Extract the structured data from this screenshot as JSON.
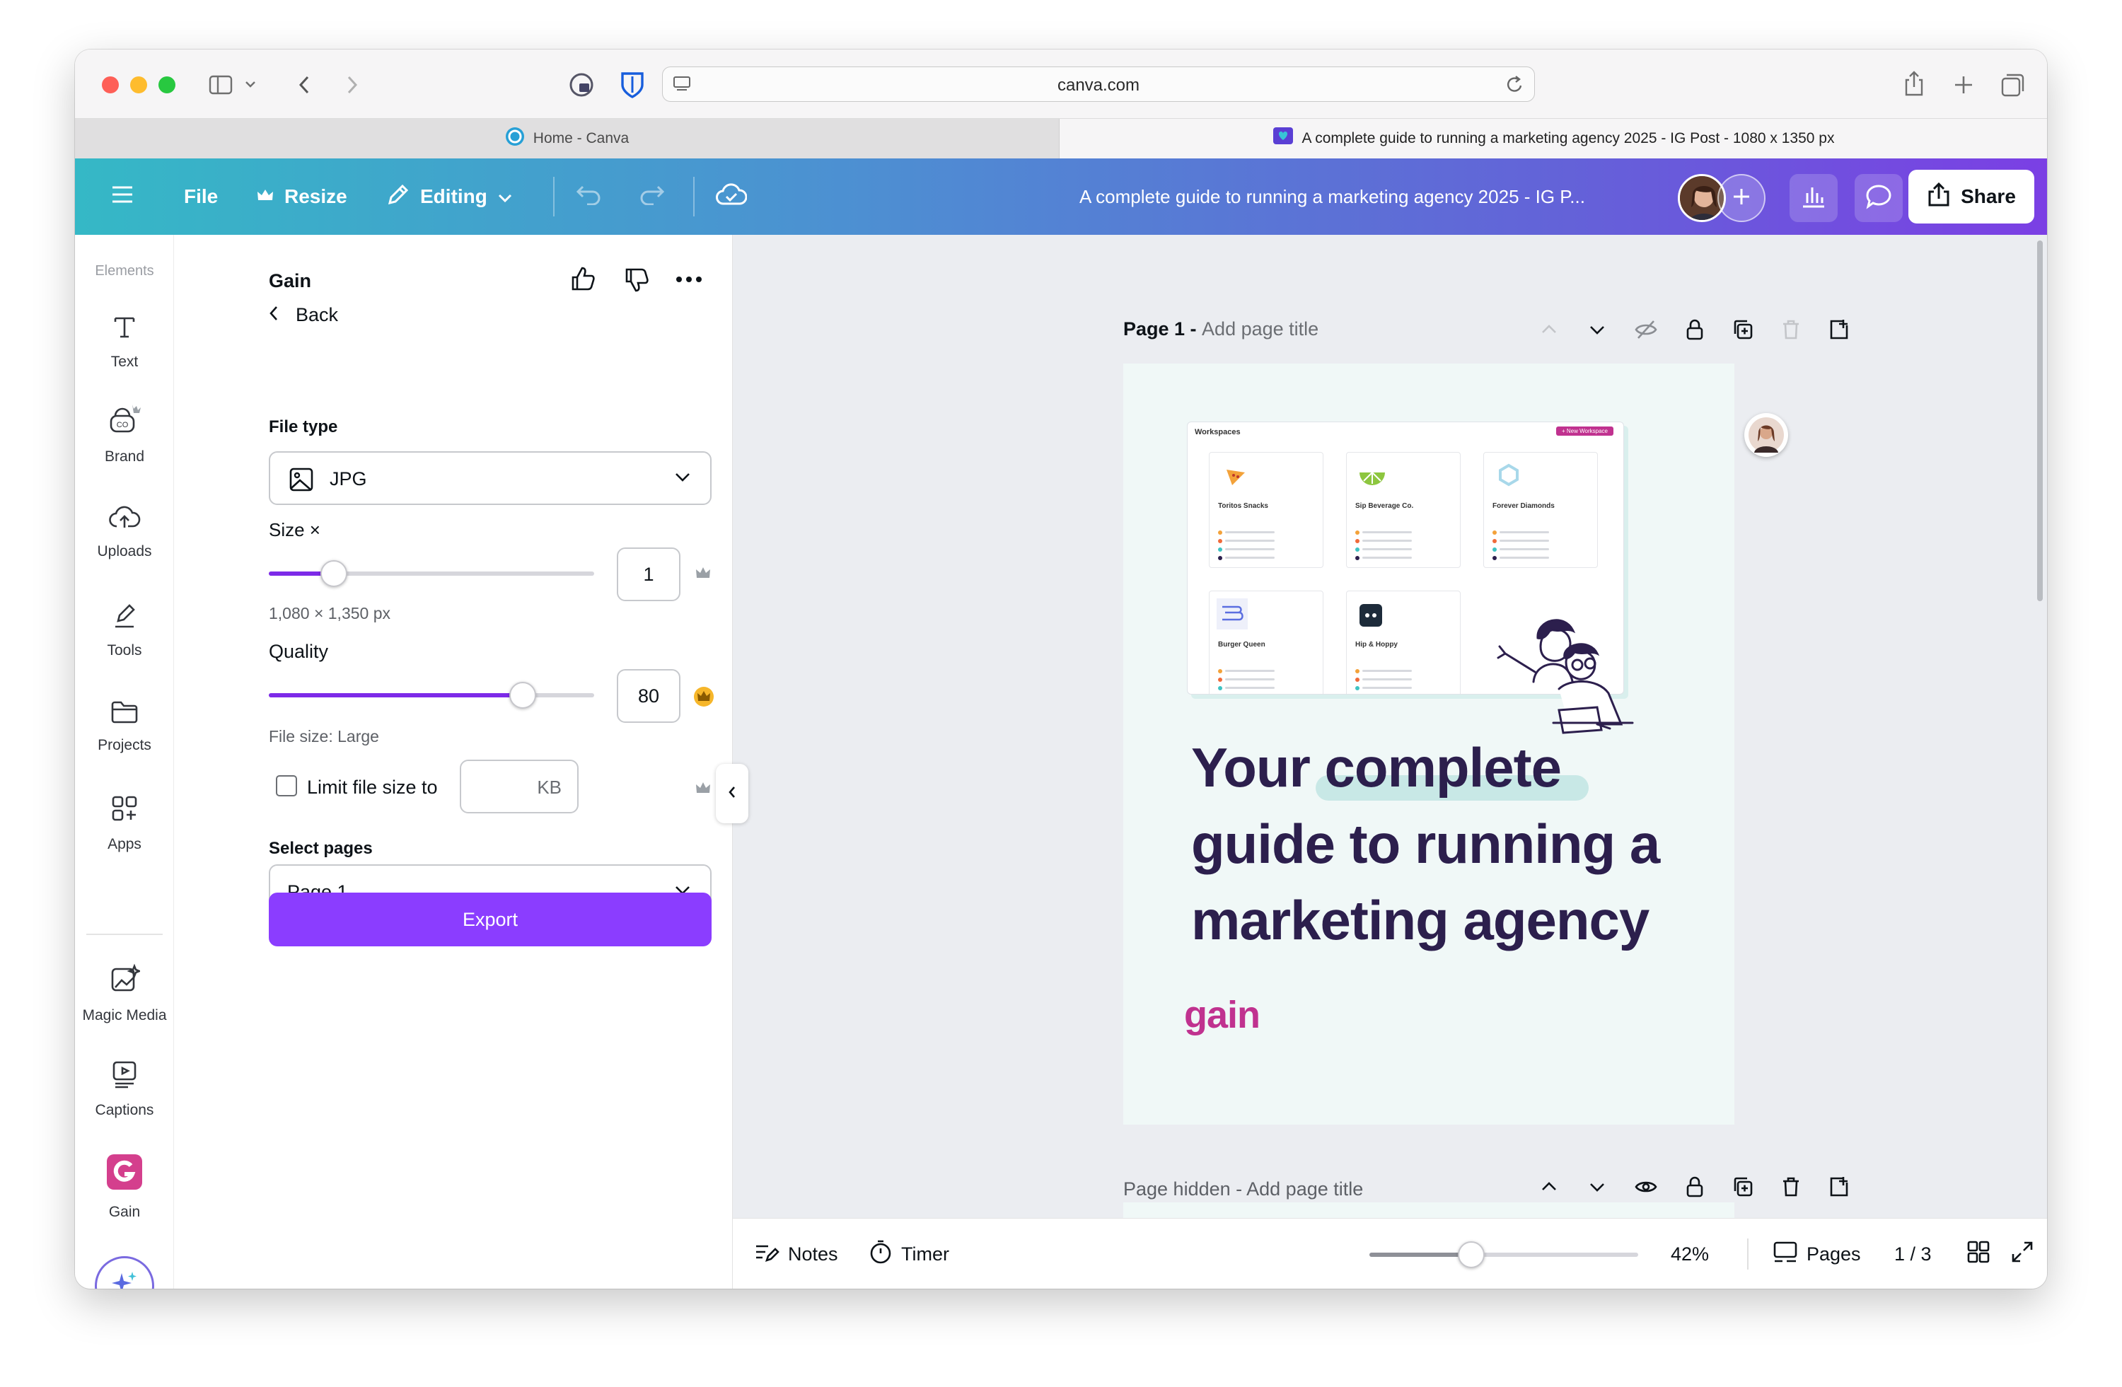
{
  "browser": {
    "url": "canva.com",
    "tabs": [
      {
        "label": "Home - Canva",
        "active": false
      },
      {
        "label": "A complete guide to running a marketing agency 2025 - IG Post - 1080 x 1350 px",
        "active": true
      }
    ]
  },
  "toolbar": {
    "file_label": "File",
    "resize_label": "Resize",
    "editing_label": "Editing",
    "doc_title": "A complete guide to running a marketing agency 2025 - IG P...",
    "share_label": "Share",
    "gradient_start": "#35b8c6",
    "gradient_end": "#7b3fe4"
  },
  "rail": {
    "header": "Elements",
    "items": [
      {
        "label": "Text",
        "icon": "text-icon"
      },
      {
        "label": "Brand",
        "icon": "brand-icon"
      },
      {
        "label": "Uploads",
        "icon": "upload-cloud-icon"
      },
      {
        "label": "Tools",
        "icon": "pen-icon"
      },
      {
        "label": "Projects",
        "icon": "folder-icon"
      },
      {
        "label": "Apps",
        "icon": "apps-grid-icon"
      },
      {
        "label": "Magic Media",
        "icon": "magic-media-icon"
      },
      {
        "label": "Captions",
        "icon": "captions-icon"
      },
      {
        "label": "Gain",
        "icon": "gain-app-icon"
      }
    ]
  },
  "panel": {
    "app_name": "Gain",
    "back_label": "Back",
    "file_type_label": "File type",
    "file_type_value": "JPG",
    "size_label": "Size ×",
    "size_value": "1",
    "size_fraction": 0.2,
    "dimensions": "1,080 × 1,350 px",
    "quality_label": "Quality",
    "quality_value": "80",
    "quality_fraction": 0.78,
    "file_size_label": "File size: Large",
    "limit_label": "Limit file size to",
    "limit_unit": "KB",
    "limit_checked": false,
    "select_pages_label": "Select pages",
    "select_pages_value": "Page 1",
    "export_label": "Export",
    "accent": "#8b3dff"
  },
  "canvas": {
    "page1_title": "Page 1 - ",
    "page1_placeholder": "Add page title",
    "page2_title": "Page hidden - Add page title",
    "design": {
      "workspaces_label": "Workspaces",
      "new_workspace_label": "+ New Workspace",
      "cards": [
        "Toritos Snacks",
        "Sip Beverage Co.",
        "Forever Diamonds",
        "Burger Queen",
        "Hip & Hoppy"
      ],
      "headline_lines": [
        "Your complete",
        "guide to running a",
        "marketing agency"
      ],
      "headline_highlight": "complete",
      "brand": "gain",
      "brand_color": "#c0328f"
    }
  },
  "bottombar": {
    "notes_label": "Notes",
    "timer_label": "Timer",
    "zoom": "42%",
    "zoom_fraction": 0.38,
    "pages_label": "Pages",
    "page_count": "1 / 3"
  }
}
